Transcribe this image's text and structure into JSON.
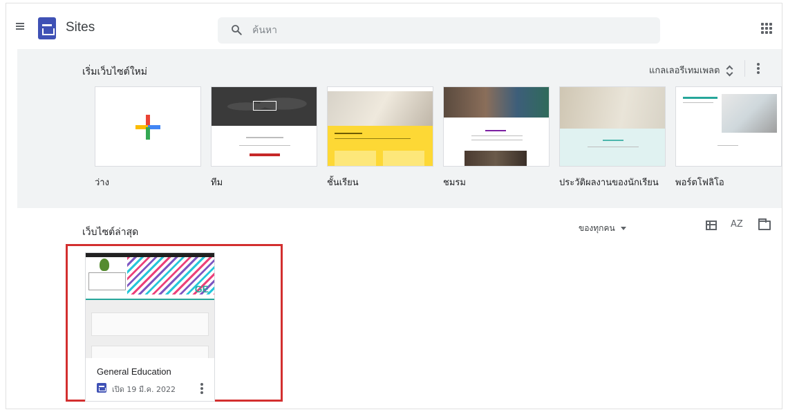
{
  "header": {
    "app_name": "Sites",
    "search_placeholder": "ค้นหา",
    "icons": {
      "menu": "hamburger-menu-icon",
      "logo": "google-sites-logo",
      "search": "search-icon",
      "apps": "apps-grid-icon"
    }
  },
  "templates": {
    "title": "เริ่มเว็บไซต์ใหม่",
    "gallery_label": "แกลเลอรีเทมเพลต",
    "items": [
      {
        "label": "ว่าง"
      },
      {
        "label": "ทีม"
      },
      {
        "label": "ชั้นเรียน"
      },
      {
        "label": "ชมรม"
      },
      {
        "label": "ประวัติผลงานของนักเรียน"
      },
      {
        "label": "พอร์ตโฟลิโอ"
      }
    ]
  },
  "recent": {
    "title": "เว็บไซต์ล่าสุด",
    "owner_filter": "ของทุกคน",
    "sort_label": "AZ",
    "sites": [
      {
        "name": "General Education",
        "opened": "เปิด 19 มี.ค. 2022",
        "thumb_logo_text": "GE"
      }
    ]
  },
  "colors": {
    "accent": "#3f51b5",
    "highlight": "#d32f2f",
    "band": "#f1f3f4"
  }
}
